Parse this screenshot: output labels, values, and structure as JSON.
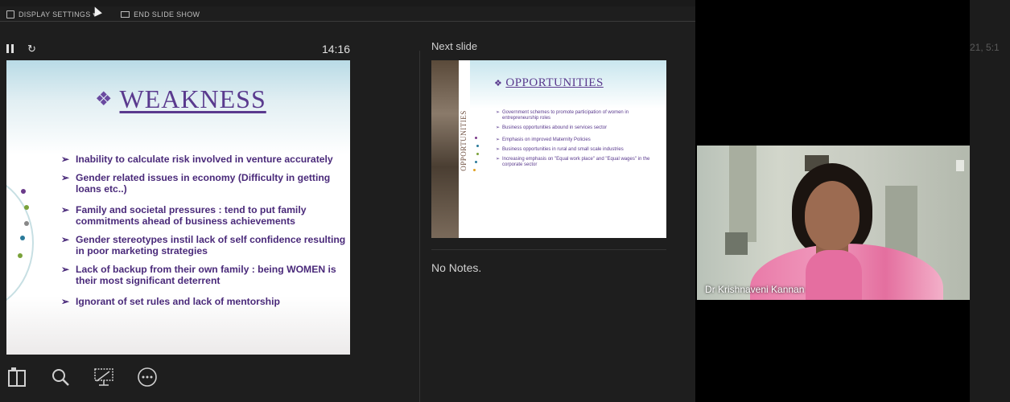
{
  "topbar": {
    "display_settings": "DISPLAY SETTINGS ▾",
    "end_slide_show": "END SLIDE SHOW"
  },
  "controls": {
    "timer": "14:16"
  },
  "current_slide": {
    "title": "WEAKNESS",
    "bullets": [
      "Inability to calculate risk involved in venture accurately",
      "Gender related issues in economy (Difficulty in getting loans etc..)",
      "Family and societal pressures : tend to put family commitments ahead of business achievements",
      "Gender stereotypes instil lack of self confidence resulting in poor marketing strategies",
      "Lack of backup from their own family : being WOMEN is their most significant deterrent",
      "Ignorant of set rules and lack of mentorship"
    ]
  },
  "next_slide": {
    "label": "Next slide",
    "title": "OPPORTUNITIES",
    "vertical_title": "OPPORTUNITIES",
    "bullets": [
      "Government schemes to promote participation of women in entrepreneurship roles",
      "Business opportunities abound in services sector",
      "Emphasis on improved Maternity Policies",
      "Business opportunities in rural and small scale industries",
      "Increasing emphasis on \"Equal work place\" and \"Equal wages\" in the corporate sector"
    ]
  },
  "notes": {
    "text": "No Notes."
  },
  "participant": {
    "name": "Dr Krishnaveni Kannan"
  },
  "clock_fragment": {
    "text": "21, 5:1"
  },
  "colors": {
    "slide_text": "#4a2a7a",
    "title_purple": "#5a3a8e",
    "dark_bg": "#1e1e1e"
  }
}
